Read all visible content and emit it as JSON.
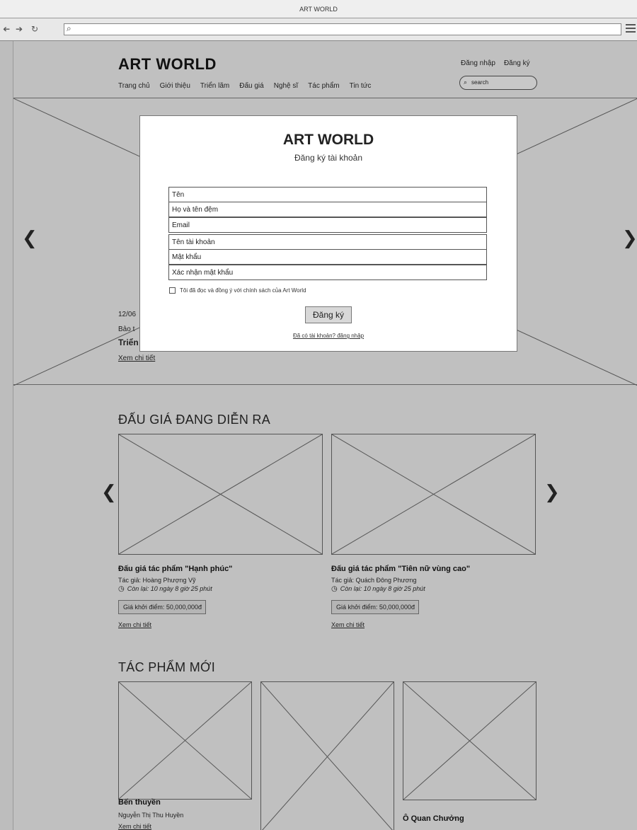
{
  "window": {
    "title": "ART WORLD"
  },
  "browser": {
    "back_icon": "left-arrow-icon",
    "forward_icon": "right-arrow-icon",
    "reload_icon": "reload-icon",
    "url": ""
  },
  "header": {
    "logo": "ART WORLD",
    "nav": [
      "Trang chủ",
      "Giới thiệu",
      "Triển lãm",
      "Đấu giá",
      "Nghệ sĩ",
      "Tác phẩm",
      "Tin tức"
    ],
    "login": "Đăng nhập",
    "register": "Đăng ký",
    "search_placeholder": "search"
  },
  "hero": {
    "date": "12/06",
    "location": "Bảo t",
    "title": "Triển",
    "detail_link": "Xem chi tiết"
  },
  "modal": {
    "title": "ART WORLD",
    "subtitle": "Đăng ký tài khoản",
    "fields": [
      "Tên",
      "Họ và tên đệm",
      "Email",
      "Tên tài khoản",
      "Mật khẩu",
      "Xác nhận mật khẩu"
    ],
    "agree_text": "Tôi đã đọc và đồng ý với chính sách của Art World",
    "agree_checked": false,
    "submit": "Đăng ký",
    "login_link": "Đã có tài khoản? đăng nhập"
  },
  "auctions": {
    "heading": "ĐẤU GIÁ ĐANG DIỄN RA",
    "items": [
      {
        "title": "Đấu giá tác phẩm \"Hạnh phúc\"",
        "author": "Tác giả: Hoàng Phượng Vỹ",
        "remaining": "Còn lại: 10 ngày 8 giờ 25 phút",
        "price": "Giá khởi điểm: 50,000,000đ",
        "detail": "Xem chi tiết"
      },
      {
        "title": "Đấu giá tác phẩm \"Tiên nữ vùng cao\"",
        "author": "Tác giả: Quách Đông Phương",
        "remaining": "Còn lại: 10 ngày 8 giờ 25 phút",
        "price": "Giá khởi điểm: 50,000,000đ",
        "detail": "Xem chi tiết"
      }
    ]
  },
  "new_works": {
    "heading": "TÁC PHẨM MỚI",
    "items": [
      {
        "title": "Bến thuyền",
        "author": "Nguyễn Thị Thu Huyền",
        "detail": "Xem chi tiết"
      },
      {
        "title": "",
        "author": ""
      },
      {
        "title": "Ô Quan Chưởng",
        "author": ""
      }
    ]
  }
}
